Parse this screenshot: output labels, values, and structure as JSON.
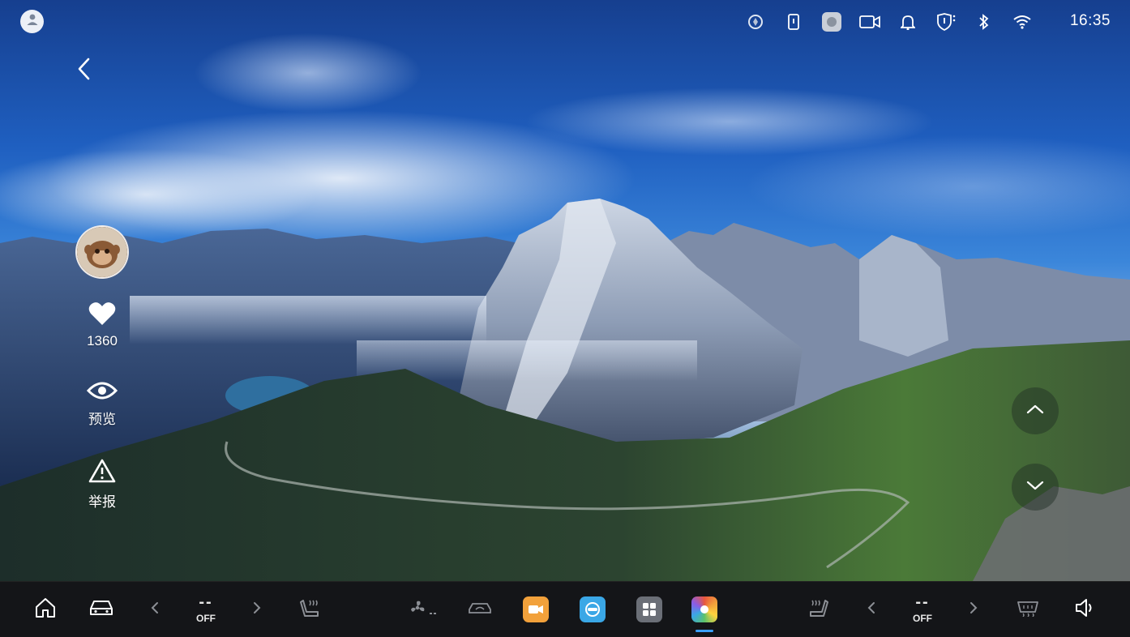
{
  "status_bar": {
    "icons": [
      "location-pin-icon",
      "phone-icon",
      "media-app-icon",
      "dashcam-icon",
      "bell-icon",
      "shield-icon",
      "bluetooth-icon",
      "wifi-icon"
    ],
    "time": "16:35"
  },
  "nav": {
    "back_icon": "chevron-left-icon"
  },
  "wallpaper": {
    "likes": "1360",
    "preview_label": "预览",
    "report_label": "举报"
  },
  "dock": {
    "left_temp": {
      "value": "--",
      "status": "OFF"
    },
    "right_temp": {
      "value": "--",
      "status": "OFF"
    },
    "apps": [
      {
        "name": "video-app",
        "color": "#f2a13b"
      },
      {
        "name": "navigation-app",
        "color": "#3aa7e6"
      },
      {
        "name": "app-grid",
        "color": "#6b6f77"
      },
      {
        "name": "wallpaper-app",
        "color": "#e8573f"
      }
    ],
    "accent_color": "#3aa0ff"
  }
}
